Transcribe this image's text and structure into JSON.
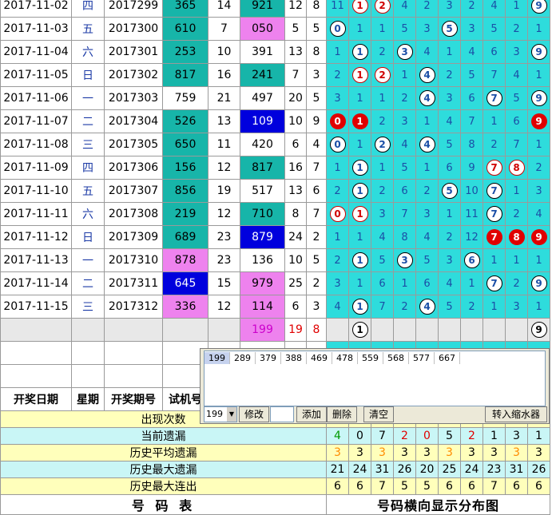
{
  "headers": {
    "date": "开奖日期",
    "weekday": "星期",
    "issue": "开奖期号",
    "trial": "试机号"
  },
  "rows": [
    {
      "date": "2017-11-02",
      "wd": "四",
      "issue": "2017299",
      "trial": "365",
      "tc": "teal",
      "s1": "14",
      "win": "921",
      "wc": "teal",
      "a": "12",
      "b": "8",
      "d": [
        {
          "t": "11"
        },
        {
          "t": "1",
          "k": "wr"
        },
        {
          "t": "2",
          "k": "wr"
        },
        {
          "t": "4"
        },
        {
          "t": "2"
        },
        {
          "t": "3"
        },
        {
          "t": "2"
        },
        {
          "t": "4"
        },
        {
          "t": "1"
        },
        {
          "t": "9",
          "k": "w"
        }
      ]
    },
    {
      "date": "2017-11-03",
      "wd": "五",
      "issue": "2017300",
      "trial": "610",
      "tc": "teal",
      "s1": "7",
      "win": "050",
      "wc": "pink",
      "a": "5",
      "b": "5",
      "d": [
        {
          "t": "0",
          "k": "w"
        },
        {
          "t": "1"
        },
        {
          "t": "1"
        },
        {
          "t": "5"
        },
        {
          "t": "3"
        },
        {
          "t": "5",
          "k": "w"
        },
        {
          "t": "3"
        },
        {
          "t": "5"
        },
        {
          "t": "2"
        },
        {
          "t": "1"
        }
      ]
    },
    {
      "date": "2017-11-04",
      "wd": "六",
      "issue": "2017301",
      "trial": "253",
      "tc": "teal",
      "s1": "10",
      "win": "391",
      "wc": "",
      "a": "13",
      "b": "8",
      "d": [
        {
          "t": "1"
        },
        {
          "t": "1",
          "k": "w"
        },
        {
          "t": "2"
        },
        {
          "t": "3",
          "k": "w"
        },
        {
          "t": "4"
        },
        {
          "t": "1"
        },
        {
          "t": "4"
        },
        {
          "t": "6"
        },
        {
          "t": "3"
        },
        {
          "t": "9",
          "k": "w"
        }
      ]
    },
    {
      "date": "2017-11-05",
      "wd": "日",
      "issue": "2017302",
      "trial": "817",
      "tc": "teal",
      "s1": "16",
      "win": "241",
      "wc": "teal",
      "a": "7",
      "b": "3",
      "d": [
        {
          "t": "2"
        },
        {
          "t": "1",
          "k": "wr"
        },
        {
          "t": "2",
          "k": "wr"
        },
        {
          "t": "1"
        },
        {
          "t": "4",
          "k": "w"
        },
        {
          "t": "2"
        },
        {
          "t": "5"
        },
        {
          "t": "7"
        },
        {
          "t": "4"
        },
        {
          "t": "1"
        }
      ]
    },
    {
      "date": "2017-11-06",
      "wd": "一",
      "issue": "2017303",
      "trial": "759",
      "tc": "",
      "s1": "21",
      "win": "497",
      "wc": "",
      "a": "20",
      "b": "5",
      "d": [
        {
          "t": "3"
        },
        {
          "t": "1"
        },
        {
          "t": "1"
        },
        {
          "t": "2"
        },
        {
          "t": "4",
          "k": "w"
        },
        {
          "t": "3"
        },
        {
          "t": "6"
        },
        {
          "t": "7",
          "k": "w"
        },
        {
          "t": "5"
        },
        {
          "t": "9",
          "k": "w"
        }
      ]
    },
    {
      "date": "2017-11-07",
      "wd": "二",
      "issue": "2017304",
      "trial": "526",
      "tc": "teal",
      "s1": "13",
      "win": "109",
      "wc": "blue",
      "a": "10",
      "b": "9",
      "d": [
        {
          "t": "0",
          "k": "r"
        },
        {
          "t": "1",
          "k": "r"
        },
        {
          "t": "2"
        },
        {
          "t": "3"
        },
        {
          "t": "1"
        },
        {
          "t": "4"
        },
        {
          "t": "7"
        },
        {
          "t": "1"
        },
        {
          "t": "6"
        },
        {
          "t": "9",
          "k": "r"
        }
      ]
    },
    {
      "date": "2017-11-08",
      "wd": "三",
      "issue": "2017305",
      "trial": "650",
      "tc": "teal",
      "s1": "11",
      "win": "420",
      "wc": "",
      "a": "6",
      "b": "4",
      "d": [
        {
          "t": "0",
          "k": "w"
        },
        {
          "t": "1"
        },
        {
          "t": "2",
          "k": "w"
        },
        {
          "t": "4"
        },
        {
          "t": "4",
          "k": "w"
        },
        {
          "t": "5"
        },
        {
          "t": "8"
        },
        {
          "t": "2"
        },
        {
          "t": "7"
        },
        {
          "t": "1"
        }
      ]
    },
    {
      "date": "2017-11-09",
      "wd": "四",
      "issue": "2017306",
      "trial": "156",
      "tc": "teal",
      "s1": "12",
      "win": "817",
      "wc": "teal",
      "a": "16",
      "b": "7",
      "d": [
        {
          "t": "1"
        },
        {
          "t": "1",
          "k": "w"
        },
        {
          "t": "1"
        },
        {
          "t": "5"
        },
        {
          "t": "1"
        },
        {
          "t": "6"
        },
        {
          "t": "9"
        },
        {
          "t": "7",
          "k": "wr"
        },
        {
          "t": "8",
          "k": "wr"
        },
        {
          "t": "2"
        }
      ]
    },
    {
      "date": "2017-11-10",
      "wd": "五",
      "issue": "2017307",
      "trial": "856",
      "tc": "teal",
      "s1": "19",
      "win": "517",
      "wc": "",
      "a": "13",
      "b": "6",
      "d": [
        {
          "t": "2"
        },
        {
          "t": "1",
          "k": "w"
        },
        {
          "t": "2"
        },
        {
          "t": "6"
        },
        {
          "t": "2"
        },
        {
          "t": "5",
          "k": "w"
        },
        {
          "t": "10"
        },
        {
          "t": "7",
          "k": "w"
        },
        {
          "t": "1"
        },
        {
          "t": "3"
        }
      ]
    },
    {
      "date": "2017-11-11",
      "wd": "六",
      "issue": "2017308",
      "trial": "219",
      "tc": "teal",
      "s1": "12",
      "win": "710",
      "wc": "teal",
      "a": "8",
      "b": "7",
      "d": [
        {
          "t": "0",
          "k": "wr"
        },
        {
          "t": "1",
          "k": "wr"
        },
        {
          "t": "3"
        },
        {
          "t": "7"
        },
        {
          "t": "3"
        },
        {
          "t": "1"
        },
        {
          "t": "11"
        },
        {
          "t": "7",
          "k": "w"
        },
        {
          "t": "2"
        },
        {
          "t": "4"
        }
      ]
    },
    {
      "date": "2017-11-12",
      "wd": "日",
      "issue": "2017309",
      "trial": "689",
      "tc": "teal",
      "s1": "23",
      "win": "879",
      "wc": "blue",
      "a": "24",
      "b": "2",
      "d": [
        {
          "t": "1"
        },
        {
          "t": "1"
        },
        {
          "t": "4"
        },
        {
          "t": "8"
        },
        {
          "t": "4"
        },
        {
          "t": "2"
        },
        {
          "t": "12"
        },
        {
          "t": "7",
          "k": "r"
        },
        {
          "t": "8",
          "k": "r"
        },
        {
          "t": "9",
          "k": "r"
        }
      ]
    },
    {
      "date": "2017-11-13",
      "wd": "一",
      "issue": "2017310",
      "trial": "878",
      "tc": "pink",
      "s1": "23",
      "win": "136",
      "wc": "",
      "a": "10",
      "b": "5",
      "d": [
        {
          "t": "2"
        },
        {
          "t": "1",
          "k": "w"
        },
        {
          "t": "5"
        },
        {
          "t": "3",
          "k": "w"
        },
        {
          "t": "5"
        },
        {
          "t": "3"
        },
        {
          "t": "6",
          "k": "w"
        },
        {
          "t": "1"
        },
        {
          "t": "1"
        },
        {
          "t": "1"
        }
      ]
    },
    {
      "date": "2017-11-14",
      "wd": "二",
      "issue": "2017311",
      "trial": "645",
      "tc": "blue",
      "s1": "15",
      "win": "979",
      "wc": "pink",
      "a": "25",
      "b": "2",
      "d": [
        {
          "t": "3"
        },
        {
          "t": "1"
        },
        {
          "t": "6"
        },
        {
          "t": "1"
        },
        {
          "t": "6"
        },
        {
          "t": "4"
        },
        {
          "t": "1"
        },
        {
          "t": "7",
          "k": "w"
        },
        {
          "t": "2"
        },
        {
          "t": "9",
          "k": "w"
        }
      ]
    },
    {
      "date": "2017-11-15",
      "wd": "三",
      "issue": "2017312",
      "trial": "336",
      "tc": "pink",
      "s1": "12",
      "win": "114",
      "wc": "pink",
      "a": "6",
      "b": "3",
      "d": [
        {
          "t": "4"
        },
        {
          "t": "1",
          "k": "w"
        },
        {
          "t": "7"
        },
        {
          "t": "2"
        },
        {
          "t": "4",
          "k": "w"
        },
        {
          "t": "5"
        },
        {
          "t": "2"
        },
        {
          "t": "1"
        },
        {
          "t": "3"
        },
        {
          "t": "1"
        }
      ]
    }
  ],
  "pending": {
    "win": "199",
    "a": "19",
    "b": "8",
    "balls": [
      "1",
      "9"
    ]
  },
  "stats": {
    "appear_label": "出现次数",
    "rows": [
      {
        "label": "当前遗漏",
        "vals": [
          "4",
          "0",
          "7",
          "2",
          "0",
          "5",
          "2",
          "1",
          "3",
          "1"
        ],
        "cls": "lblue"
      },
      {
        "label": "历史平均遗漏",
        "vals": [
          "3",
          "3",
          "3",
          "3",
          "3",
          "3",
          "3",
          "3",
          "3",
          "3"
        ],
        "cls": "yel"
      },
      {
        "label": "历史最大遗漏",
        "vals": [
          "21",
          "24",
          "31",
          "26",
          "20",
          "25",
          "24",
          "23",
          "31",
          "26"
        ],
        "cls": "lblue"
      },
      {
        "label": "历史最大连出",
        "vals": [
          "6",
          "6",
          "7",
          "5",
          "5",
          "6",
          "6",
          "7",
          "6",
          "6"
        ],
        "cls": "yel"
      }
    ],
    "current_colors": [
      "#009900",
      "#000",
      "#000",
      "#e00000",
      "#e00000",
      "#000",
      "#e00000",
      "#000",
      "#000",
      "#000"
    ],
    "avg_colors": [
      "#ff8c00",
      "#000",
      "#ff8c00",
      "#000",
      "#000",
      "#ff8c00",
      "#000",
      "#000",
      "#ff8c00",
      "#000"
    ]
  },
  "footer": {
    "left": "号 码 表",
    "right": "号码横向显示分布图"
  },
  "popup": {
    "items": [
      "199",
      "289",
      "379",
      "388",
      "469",
      "478",
      "559",
      "568",
      "577",
      "667"
    ],
    "combo": "199",
    "btn_modify": "修改",
    "btn_add": "添加",
    "btn_delete": "删除",
    "btn_clear": "清空",
    "btn_shrink": "转入缩水器"
  }
}
